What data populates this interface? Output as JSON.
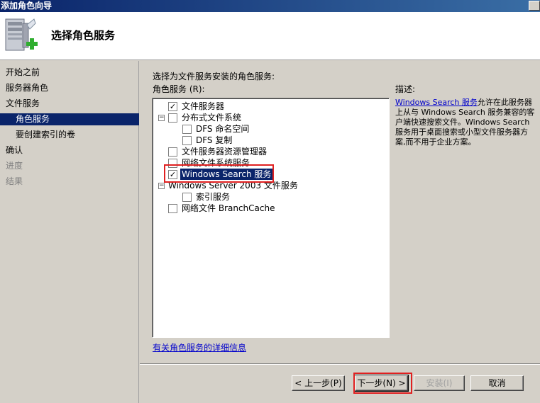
{
  "window": {
    "title": "添加角色向导"
  },
  "header": {
    "title": "选择角色服务",
    "icon": "server-add-icon"
  },
  "nav": {
    "items": [
      {
        "label": "开始之前",
        "state": "normal"
      },
      {
        "label": "服务器角色",
        "state": "normal"
      },
      {
        "label": "文件服务",
        "state": "normal"
      },
      {
        "label": "角色服务",
        "state": "active"
      },
      {
        "label": "要创建索引的卷",
        "state": "normal"
      },
      {
        "label": "确认",
        "state": "normal"
      },
      {
        "label": "进度",
        "state": "disabled"
      },
      {
        "label": "结果",
        "state": "disabled"
      }
    ]
  },
  "main": {
    "instruction": "选择为文件服务安装的角色服务:",
    "list_label": "角色服务 (R):",
    "tree": [
      {
        "label": "文件服务器",
        "checked": true,
        "level": 1
      },
      {
        "label": "分布式文件系统",
        "checked": false,
        "level": 1,
        "expander": "minus"
      },
      {
        "label": "DFS 命名空间",
        "checked": false,
        "level": 2
      },
      {
        "label": "DFS 复制",
        "checked": false,
        "level": 2
      },
      {
        "label": "文件服务器资源管理器",
        "checked": false,
        "level": 1
      },
      {
        "label": "网络文件系统服务",
        "checked": false,
        "level": 1
      },
      {
        "label": "Windows Search 服务",
        "checked": true,
        "level": 1,
        "selected": true
      },
      {
        "label": "Windows Server 2003 文件服务",
        "checked": false,
        "level": 1,
        "expander": "minus"
      },
      {
        "label": "索引服务",
        "checked": false,
        "level": 2
      },
      {
        "label": "网络文件 BranchCache",
        "checked": false,
        "level": 1
      }
    ],
    "description": {
      "label": "描述:",
      "link": "Windows Search 服务",
      "text": "允许在此服务器上从与 Windows Search 服务兼容的客户端快速搜索文件。Windows Search 服务用于桌面搜索或小型文件服务器方案,而不用于企业方案。"
    },
    "more_info_link": "有关角色服务的详细信息"
  },
  "buttons": {
    "back": "< 上一步(P)",
    "next": "下一步(N) >",
    "install": "安装(I)",
    "cancel": "取消"
  },
  "colors": {
    "highlight": "#0a246a",
    "annotation": "#e02020",
    "link": "#0000cc"
  }
}
